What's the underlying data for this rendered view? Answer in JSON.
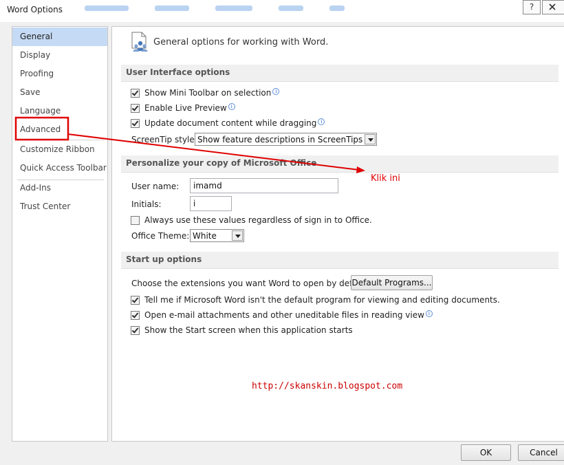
{
  "window": {
    "title": "Word Options",
    "help_label": "?"
  },
  "sidebar": {
    "items": [
      {
        "label": "General"
      },
      {
        "label": "Display"
      },
      {
        "label": "Proofing"
      },
      {
        "label": "Save"
      },
      {
        "label": "Language"
      },
      {
        "label": "Advanced"
      },
      {
        "label": "Customize Ribbon"
      },
      {
        "label": "Quick Access Toolbar"
      },
      {
        "label": "Add-Ins"
      },
      {
        "label": "Trust Center"
      }
    ],
    "selected": "General"
  },
  "header": {
    "text": "General options for working with Word.",
    "icon": "general-options-icon"
  },
  "ui_options": {
    "title": "User Interface options",
    "mini_toolbar": {
      "label": "Show Mini Toolbar on selection",
      "checked": true
    },
    "live_preview": {
      "label": "Enable Live Preview",
      "checked": true
    },
    "update_dragging": {
      "label": "Update document content while dragging",
      "checked": true
    },
    "screentip": {
      "label": "ScreenTip style:",
      "value": "Show feature descriptions in ScreenTips"
    }
  },
  "personalize": {
    "title": "Personalize your copy of Microsoft Office",
    "user_name": {
      "label": "User name:",
      "value": "imamd"
    },
    "initials": {
      "label": "Initials:",
      "value": "i"
    },
    "always_use": {
      "label": "Always use these values regardless of sign in to Office.",
      "checked": false
    },
    "theme": {
      "label": "Office Theme:",
      "value": "White"
    }
  },
  "startup": {
    "title": "Start up options",
    "extensions_label": "Choose the extensions you want Word to open by default:",
    "default_programs_button": "Default Programs...",
    "tell_me": {
      "label": "Tell me if Microsoft Word isn't the default program for viewing and editing documents.",
      "checked": true
    },
    "open_email": {
      "label": "Open e-mail attachments and other uneditable files in reading view",
      "checked": true
    },
    "show_start": {
      "label": "Show the Start screen when this application starts",
      "checked": true
    }
  },
  "footer": {
    "ok": "OK",
    "cancel": "Cancel"
  },
  "annotation": {
    "text": "Klik ini",
    "color": "#e00000"
  },
  "watermark": {
    "text": "http://skanskin.blogspot.com"
  }
}
